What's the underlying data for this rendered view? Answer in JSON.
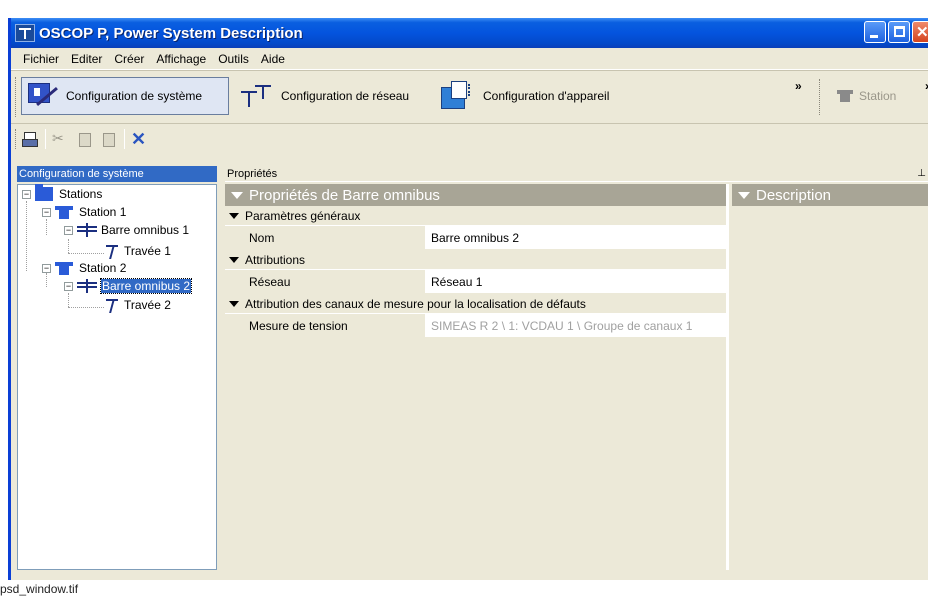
{
  "window": {
    "title": "OSCOP P, Power System Description",
    "icons": {
      "app": "oscop-app-icon",
      "minimize": "minimize-icon",
      "maximize": "maximize-icon",
      "close": "close-icon"
    }
  },
  "menu": [
    "Fichier",
    "Editer",
    "Créer",
    "Affichage",
    "Outils",
    "Aide"
  ],
  "toolbar_big": {
    "system_config": "Configuration de système",
    "network_config": "Configuration de réseau",
    "device_config": "Configuration d'appareil",
    "overflow": "»",
    "overflow2": "»",
    "station": "Station"
  },
  "toolbar_small": {
    "icons": [
      "print-icon",
      "cut-icon",
      "copy-icon",
      "paste-icon",
      "delete-icon"
    ]
  },
  "tree_panel": {
    "header": "Configuration de système",
    "nodes": {
      "stations": "Stations",
      "station1": "Station 1",
      "busbar1": "Barre omnibus 1",
      "bay1": "Travée 1",
      "station2": "Station 2",
      "busbar2": "Barre omnibus 2",
      "bay2": "Travée 2"
    },
    "selected": "Barre omnibus 2"
  },
  "properties_panel": {
    "header": "Propriétés",
    "pin": "⊥",
    "section_title": "Propriétés de Barre omnibus",
    "description_title": "Description",
    "categories": [
      {
        "label": "Paramètres généraux",
        "rows": [
          {
            "name": "Nom",
            "value": "Barre omnibus 2"
          }
        ]
      },
      {
        "label": "Attributions",
        "rows": [
          {
            "name": "Réseau",
            "value": "Réseau 1"
          }
        ]
      },
      {
        "label": "Attribution des canaux de mesure pour la localisation de défauts",
        "rows": [
          {
            "name": "Mesure de tension",
            "value": "SIMEAS R 2 \\ 1: VCDAU 1 \\ Groupe de canaux 1"
          }
        ]
      }
    ]
  },
  "caption": "psd_window.tif"
}
